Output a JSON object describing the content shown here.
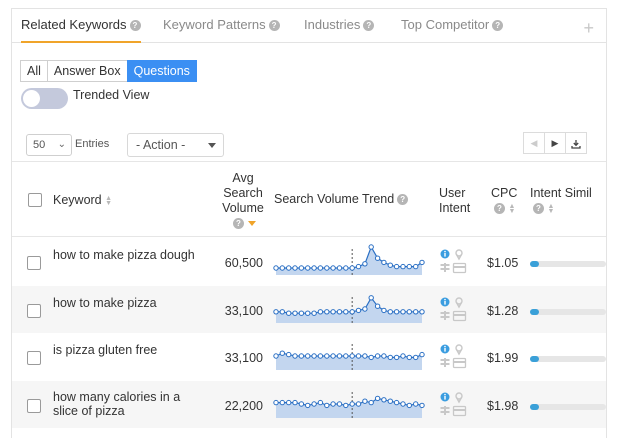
{
  "tabs": [
    {
      "label": "Related Keywords",
      "active": true
    },
    {
      "label": "Keyword Patterns",
      "active": false
    },
    {
      "label": "Industries",
      "active": false
    },
    {
      "label": "Top Competitor",
      "active": false
    }
  ],
  "filters": {
    "segments": [
      {
        "label": "All",
        "active": false
      },
      {
        "label": "Answer Box",
        "active": false
      },
      {
        "label": "Questions",
        "active": true
      }
    ],
    "trended_view_label": "Trended View",
    "trended_view_on": false
  },
  "controls": {
    "entries_value": "50",
    "entries_label": "Entries",
    "action_value": "- Action -"
  },
  "table": {
    "headers": {
      "keyword": "Keyword",
      "avg_1": "Avg",
      "avg_2": "Search",
      "avg_3": "Volume",
      "trend": "Search Volume Trend",
      "user_1": "User",
      "user_2": "Intent",
      "cpc": "CPC",
      "intent_sim": "Intent Simil"
    },
    "rows": [
      {
        "keyword": "how to make pizza dough",
        "volume": "60,500",
        "cpc": "$1.05",
        "intent_similarity": 0.12,
        "trend": [
          5,
          5,
          5,
          5,
          5,
          5,
          5,
          5,
          5,
          5,
          5,
          5,
          5,
          6,
          8,
          20,
          12,
          9,
          7,
          6,
          6,
          6,
          6,
          9
        ]
      },
      {
        "keyword": "how to make pizza",
        "volume": "33,100",
        "cpc": "$1.28",
        "intent_similarity": 0.12,
        "trend": [
          8,
          8,
          7,
          7,
          7,
          7,
          7,
          8,
          8,
          8,
          8,
          8,
          8,
          9,
          10,
          18,
          12,
          9,
          8,
          8,
          8,
          8,
          8,
          8
        ]
      },
      {
        "keyword": "is pizza gluten free",
        "volume": "33,100",
        "cpc": "$1.99",
        "intent_similarity": 0.12,
        "trend": [
          10,
          12,
          11,
          10,
          10,
          10,
          10,
          10,
          10,
          10,
          10,
          10,
          10,
          10,
          10,
          9,
          10,
          10,
          9,
          9,
          10,
          9,
          9,
          11
        ]
      },
      {
        "keyword": "how many calories in a slice of pizza",
        "volume": "22,200",
        "cpc": "$1.98",
        "intent_similarity": 0.12,
        "trend": [
          11,
          11,
          11,
          11,
          10,
          9,
          10,
          11,
          9,
          10,
          10,
          9,
          10,
          10,
          12,
          11,
          14,
          13,
          12,
          11,
          10,
          9,
          10,
          9
        ]
      }
    ]
  },
  "colors": {
    "accent": "#3b8ff3",
    "tab_underline": "#f0a42a",
    "trend_line": "#2a6fc4",
    "trend_fill": "#c3d6ef",
    "info_icon": "#3b9de0",
    "intent_bar": "#3aa0d8"
  }
}
